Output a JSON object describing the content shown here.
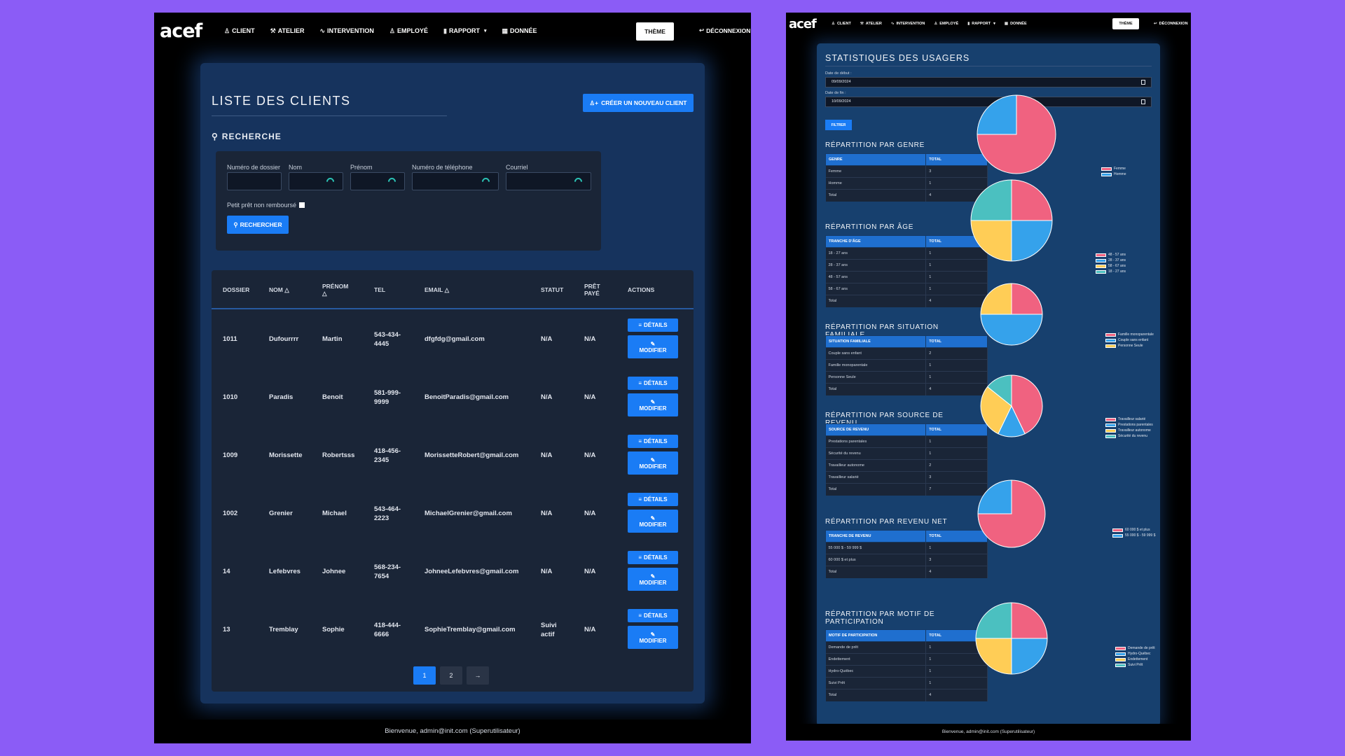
{
  "colors": {
    "accent": "#1a7cf5",
    "background": "#8b5cf6",
    "pink": "#f06280",
    "blue": "#35a2eb",
    "yellow": "#ffcd56",
    "teal": "#4bc0c0"
  },
  "nav": {
    "logo": "acef",
    "items": [
      {
        "icon": "person-icon",
        "label": "CLIENT"
      },
      {
        "icon": "hammer-icon",
        "label": "ATELIER"
      },
      {
        "icon": "pulse-icon",
        "label": "INTERVENTION"
      },
      {
        "icon": "people-icon",
        "label": "EMPLOYÉ"
      },
      {
        "icon": "bar-chart-icon",
        "label": "RAPPORT"
      },
      {
        "icon": "database-icon",
        "label": "DONNÉE"
      }
    ],
    "theme": "THÈME",
    "logout": "DÉCONNEXION"
  },
  "clients": {
    "title": "LISTE DES CLIENTS",
    "create_btn": "CRÉER UN NOUVEAU CLIENT",
    "search_title": "RECHERCHE",
    "fields": [
      "Numéro de dossier",
      "Nom",
      "Prénom",
      "Numéro de téléphone",
      "Courriel"
    ],
    "checkbox_label": "Petit prêt non remboursé",
    "search_btn": "RECHERCHER",
    "columns": [
      "DOSSIER",
      "NOM",
      "PRÉNOM",
      "TEL",
      "EMAIL",
      "STATUT",
      "PRÊT PAYÉ",
      "ACTIONS"
    ],
    "rows": [
      {
        "dossier": "1011",
        "nom": "Dufourrrr",
        "prenom": "Martin",
        "tel": "543-434-4445",
        "email": "dfgfdg@gmail.com",
        "statut": "N/A",
        "pret": "N/A"
      },
      {
        "dossier": "1010",
        "nom": "Paradis",
        "prenom": "Benoit",
        "tel": "581-999-9999",
        "email": "BenoitParadis@gmail.com",
        "statut": "N/A",
        "pret": "N/A"
      },
      {
        "dossier": "1009",
        "nom": "Morissette",
        "prenom": "Robertsss",
        "tel": "418-456-2345",
        "email": "MorissetteRobert@gmail.com",
        "statut": "N/A",
        "pret": "N/A"
      },
      {
        "dossier": "1002",
        "nom": "Grenier",
        "prenom": "Michael",
        "tel": "543-464-2223",
        "email": "MichaelGrenier@gmail.com",
        "statut": "N/A",
        "pret": "N/A"
      },
      {
        "dossier": "14",
        "nom": "Lefebvres",
        "prenom": "Johnee",
        "tel": "568-234-7654",
        "email": "JohneeLefebvres@gmail.com",
        "statut": "N/A",
        "pret": "N/A"
      },
      {
        "dossier": "13",
        "nom": "Tremblay",
        "prenom": "Sophie",
        "tel": "418-444-6666",
        "email": "SophieTremblay@gmail.com",
        "statut": "Suivi actif",
        "pret": "N/A"
      }
    ],
    "details_btn": "DÉTAILS",
    "modify_btn": "MODIFIER",
    "pages": [
      "1",
      "2",
      "→"
    ],
    "footer": "Bienvenue, admin@init.com (Superutilisateur)"
  },
  "stats": {
    "title": "STATISTIQUES DES USAGERS",
    "start_label": "Date de début :",
    "start_value": "09/09/2024",
    "end_label": "Date de fin :",
    "end_value": "10/09/2024",
    "filter_btn": "FILTRER",
    "footer": "Bienvenue, admin@init.com (Superutilisateur)",
    "sections": [
      {
        "title": "RÉPARTITION PAR GENRE",
        "head": [
          "GENRE",
          "TOTAL"
        ],
        "rows": [
          [
            "Femme",
            "3"
          ],
          [
            "Homme",
            "1"
          ],
          [
            "Total",
            "4"
          ]
        ],
        "legend": [
          "Femme",
          "Homme"
        ]
      },
      {
        "title": "RÉPARTITION PAR ÂGE",
        "head": [
          "TRANCHE D'ÂGE",
          "TOTAL"
        ],
        "rows": [
          [
            "18 - 27 ans",
            "1"
          ],
          [
            "28 - 37 ans",
            "1"
          ],
          [
            "48 - 57 ans",
            "1"
          ],
          [
            "58 - 67 ans",
            "1"
          ],
          [
            "Total",
            "4"
          ]
        ],
        "legend": [
          "48 - 57 ans",
          "28 - 37 ans",
          "58 - 67 ans",
          "18 - 27 ans"
        ]
      },
      {
        "title": "RÉPARTITION PAR SITUATION FAMILIALE",
        "head": [
          "SITUATION FAMILIALE",
          "TOTAL"
        ],
        "rows": [
          [
            "Couple sans enfant",
            "2"
          ],
          [
            "Famille monoparentale",
            "1"
          ],
          [
            "Personne Seule",
            "1"
          ],
          [
            "Total",
            "4"
          ]
        ],
        "legend": [
          "Famille monoparentale",
          "Couple sans enfant",
          "Personne Seule"
        ]
      },
      {
        "title": "RÉPARTITION PAR SOURCE DE REVENU",
        "head": [
          "SOURCE DE REVENU",
          "TOTAL"
        ],
        "rows": [
          [
            "Prestations parentales",
            "1"
          ],
          [
            "Sécurité du revenu",
            "1"
          ],
          [
            "Travailleur autonome",
            "2"
          ],
          [
            "Travailleur salarié",
            "3"
          ],
          [
            "Total",
            "7"
          ]
        ],
        "legend": [
          "Travailleur salarié",
          "Prestations parentales",
          "Travailleur autonome",
          "Sécurité du revenu"
        ]
      },
      {
        "title": "RÉPARTITION PAR REVENU NET",
        "head": [
          "TRANCHE DE REVENU",
          "TOTAL"
        ],
        "rows": [
          [
            "55 000 $ - 59 999 $",
            "1"
          ],
          [
            "60 000 $ et plus",
            "3"
          ],
          [
            "Total",
            "4"
          ]
        ],
        "legend": [
          "60 000 $ et plus",
          "55 000 $ - 59 999 $"
        ]
      },
      {
        "title": "RÉPARTITION PAR MOTIF DE PARTICIPATION",
        "head": [
          "MOTIF DE PARTICIPATION",
          "TOTAL"
        ],
        "rows": [
          [
            "Demande de prêt",
            "1"
          ],
          [
            "Endettement",
            "1"
          ],
          [
            "Hydro-Québec",
            "1"
          ],
          [
            "Suivi Prêt",
            "1"
          ],
          [
            "Total",
            "4"
          ]
        ],
        "legend": [
          "Demande de prêt",
          "Hydro-Québec",
          "Endettement",
          "Suivi Prêt"
        ]
      }
    ]
  },
  "chart_data": [
    {
      "type": "pie",
      "categories": [
        "Femme",
        "Homme"
      ],
      "values": [
        3,
        1
      ]
    },
    {
      "type": "pie",
      "categories": [
        "48 - 57 ans",
        "28 - 37 ans",
        "58 - 67 ans",
        "18 - 27 ans"
      ],
      "values": [
        1,
        1,
        1,
        1
      ]
    },
    {
      "type": "pie",
      "categories": [
        "Famille monoparentale",
        "Couple sans enfant",
        "Personne Seule"
      ],
      "values": [
        1,
        2,
        1
      ]
    },
    {
      "type": "pie",
      "categories": [
        "Travailleur salarié",
        "Prestations parentales",
        "Travailleur autonome",
        "Sécurité du revenu"
      ],
      "values": [
        3,
        1,
        2,
        1
      ]
    },
    {
      "type": "pie",
      "categories": [
        "60 000 $ et plus",
        "55 000 $ - 59 999 $"
      ],
      "values": [
        3,
        1
      ]
    },
    {
      "type": "pie",
      "categories": [
        "Demande de prêt",
        "Hydro-Québec",
        "Endettement",
        "Suivi Prêt"
      ],
      "values": [
        1,
        1,
        1,
        1
      ]
    }
  ]
}
